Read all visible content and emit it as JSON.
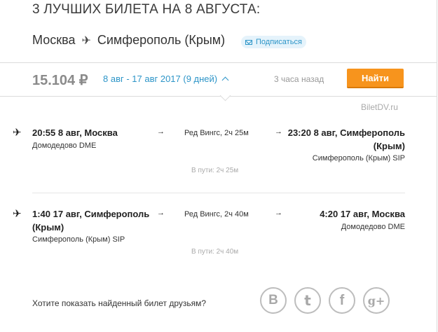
{
  "header": {
    "title": "3 ЛУЧШИХ БИЛЕТА НА 8 АВГУСТА:",
    "origin": "Москва",
    "destination": "Симферополь (Крым)",
    "subscribe_label": "Подписаться"
  },
  "search_bar": {
    "price": "15.104 ₽",
    "dates": "8 авг - 17 авг 2017 (9 дней)",
    "updated": "3 часа назад",
    "find_button": "Найти"
  },
  "source": "BiletDV.ru",
  "flights": [
    {
      "departure": "20:55 8 авг, Москва",
      "departure_airport": "Домодедово DME",
      "airline": "Ред Вингс, 2ч 25м",
      "arrival": "23:20 8 авг, Симферополь (Крым)",
      "arrival_airport": "Симферополь (Крым) SIP",
      "travel_time": "В пути: 2ч 25м"
    },
    {
      "departure": "1:40 17 авг, Симферополь (Крым)",
      "departure_airport": "Симферополь (Крым) SIP",
      "airline": "Ред Вингс, 2ч 40м",
      "arrival": "4:20 17 авг, Москва",
      "arrival_airport": "Домодедово DME",
      "travel_time": "В пути: 2ч 40м"
    }
  ],
  "share": {
    "prompt": "Хотите показать найденный билет друзьям?",
    "networks": [
      {
        "name": "vkontakte",
        "glyph": "B"
      },
      {
        "name": "twitter",
        "glyph": "t"
      },
      {
        "name": "facebook",
        "glyph": "f"
      },
      {
        "name": "google-plus",
        "glyph": "g+"
      }
    ]
  },
  "colors": {
    "accent": "#2d95c8",
    "button": "#f7941d",
    "price": "#8a8a8a"
  }
}
